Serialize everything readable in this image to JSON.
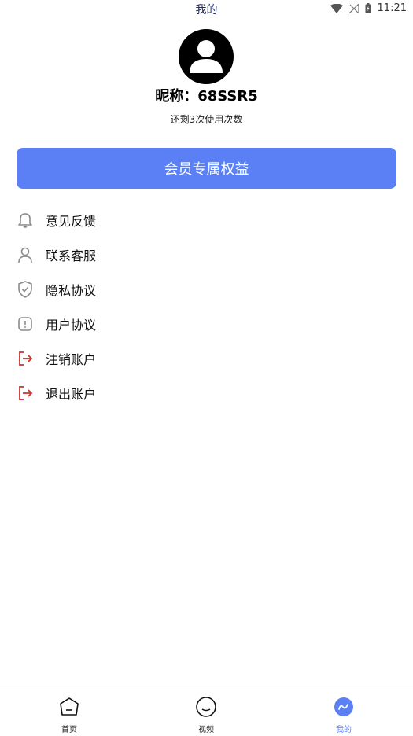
{
  "status_bar": {
    "title": "我的",
    "time": "11:21"
  },
  "profile": {
    "nickname": "昵称：68SSR5",
    "remaining": "还剩3次使用次数"
  },
  "vip_button": {
    "label": "会员专属权益"
  },
  "menu": [
    {
      "icon": "bell-icon",
      "label": "意见反馈"
    },
    {
      "icon": "person-icon",
      "label": "联系客服"
    },
    {
      "icon": "shield-check-icon",
      "label": "隐私协议"
    },
    {
      "icon": "alert-box-icon",
      "label": "用户协议"
    },
    {
      "icon": "logout-icon",
      "label": "注销账户"
    },
    {
      "icon": "logout-icon",
      "label": "退出账户"
    }
  ],
  "bottom_nav": [
    {
      "icon": "home-face-icon",
      "label": "首页",
      "active": false
    },
    {
      "icon": "video-face-icon",
      "label": "视频",
      "active": false
    },
    {
      "icon": "mine-wave-icon",
      "label": "我的",
      "active": true
    }
  ],
  "colors": {
    "accent": "#5b80f5",
    "danger": "#c8352b",
    "icon_gray": "#8a8a8a"
  }
}
